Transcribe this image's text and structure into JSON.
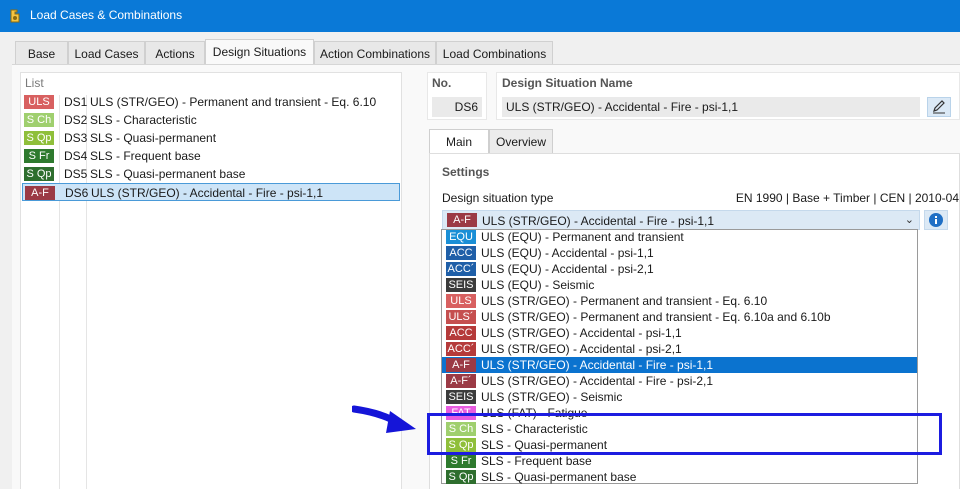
{
  "window": {
    "title": "Load Cases & Combinations"
  },
  "tabs": [
    {
      "label": "Base"
    },
    {
      "label": "Load Cases"
    },
    {
      "label": "Actions"
    },
    {
      "label": "Design Situations"
    },
    {
      "label": "Action Combinations"
    },
    {
      "label": "Load Combinations"
    }
  ],
  "list": {
    "header": "List",
    "rows": [
      {
        "badge": "ULS",
        "badge_color": "#d86060",
        "code": "DS1",
        "name": "ULS (STR/GEO) - Permanent and transient - Eq. 6.10"
      },
      {
        "badge": "S Ch",
        "badge_color": "#9fcf6e",
        "code": "DS2",
        "name": "SLS - Characteristic"
      },
      {
        "badge": "S Qp",
        "badge_color": "#8fbf3a",
        "code": "DS3",
        "name": "SLS - Quasi-permanent"
      },
      {
        "badge": "S Fr",
        "badge_color": "#2e7a2e",
        "code": "DS4",
        "name": "SLS - Frequent base"
      },
      {
        "badge": "S Qp",
        "badge_color": "#2e6e2e",
        "code": "DS5",
        "name": "SLS - Quasi-permanent base"
      },
      {
        "badge": "A-F",
        "badge_color": "#9b3a45",
        "code": "DS6",
        "name": "ULS (STR/GEO) - Accidental - Fire - psi-1,1"
      }
    ]
  },
  "details": {
    "no_label": "No.",
    "no_value": "DS6",
    "name_label": "Design Situation Name",
    "name_value": "ULS (STR/GEO) - Accidental - Fire - psi-1,1"
  },
  "subtabs": [
    {
      "label": "Main"
    },
    {
      "label": "Overview"
    }
  ],
  "settings": {
    "header": "Settings",
    "type_label": "Design situation type",
    "standard": "EN 1990 | Base + Timber | CEN | 2010-04",
    "selected": {
      "badge": "A-F",
      "badge_color": "#9b3a45",
      "text": "ULS (STR/GEO) - Accidental - Fire - psi-1,1"
    }
  },
  "dropdown": {
    "items": [
      {
        "badge": "EQU",
        "badge_color": "#1a8fd6",
        "text": "ULS (EQU) - Permanent and transient"
      },
      {
        "badge": "ACC",
        "badge_color": "#1f5fa8",
        "text": "ULS (EQU) - Accidental - psi-1,1"
      },
      {
        "badge": "ACC´",
        "badge_color": "#1f5fa8",
        "text": "ULS (EQU) - Accidental - psi-2,1"
      },
      {
        "badge": "SEIS",
        "badge_color": "#3b3b3b",
        "text": "ULS (EQU) - Seismic"
      },
      {
        "badge": "ULS",
        "badge_color": "#d86060",
        "text": "ULS (STR/GEO) - Permanent and transient - Eq. 6.10"
      },
      {
        "badge": "ULS´",
        "badge_color": "#c54f4f",
        "text": "ULS (STR/GEO) - Permanent and transient - Eq. 6.10a and 6.10b"
      },
      {
        "badge": "ACC",
        "badge_color": "#b53a3a",
        "text": "ULS (STR/GEO) - Accidental - psi-1,1"
      },
      {
        "badge": "ACC´",
        "badge_color": "#b53a3a",
        "text": "ULS (STR/GEO) - Accidental - psi-2,1"
      },
      {
        "badge": "A-F",
        "badge_color": "#9b3a45",
        "text": "ULS (STR/GEO) - Accidental - Fire - psi-1,1",
        "selected": true
      },
      {
        "badge": "A-F´",
        "badge_color": "#9b3a45",
        "text": "ULS (STR/GEO) - Accidental - Fire - psi-2,1"
      },
      {
        "badge": "SEIS",
        "badge_color": "#3b3b3b",
        "text": "ULS (STR/GEO) - Seismic"
      },
      {
        "badge": "FAT",
        "badge_color": "#e85be0",
        "text": "ULS (FAT) - Fatigue"
      },
      {
        "badge": "S Ch",
        "badge_color": "#9fcf6e",
        "text": "SLS - Characteristic"
      },
      {
        "badge": "S Qp",
        "badge_color": "#8fbf3a",
        "text": "SLS - Quasi-permanent"
      },
      {
        "badge": "S Fr",
        "badge_color": "#2e7a2e",
        "text": "SLS - Frequent base"
      },
      {
        "badge": "S Qp",
        "badge_color": "#2e6e2e",
        "text": "SLS - Quasi-permanent base"
      }
    ]
  }
}
